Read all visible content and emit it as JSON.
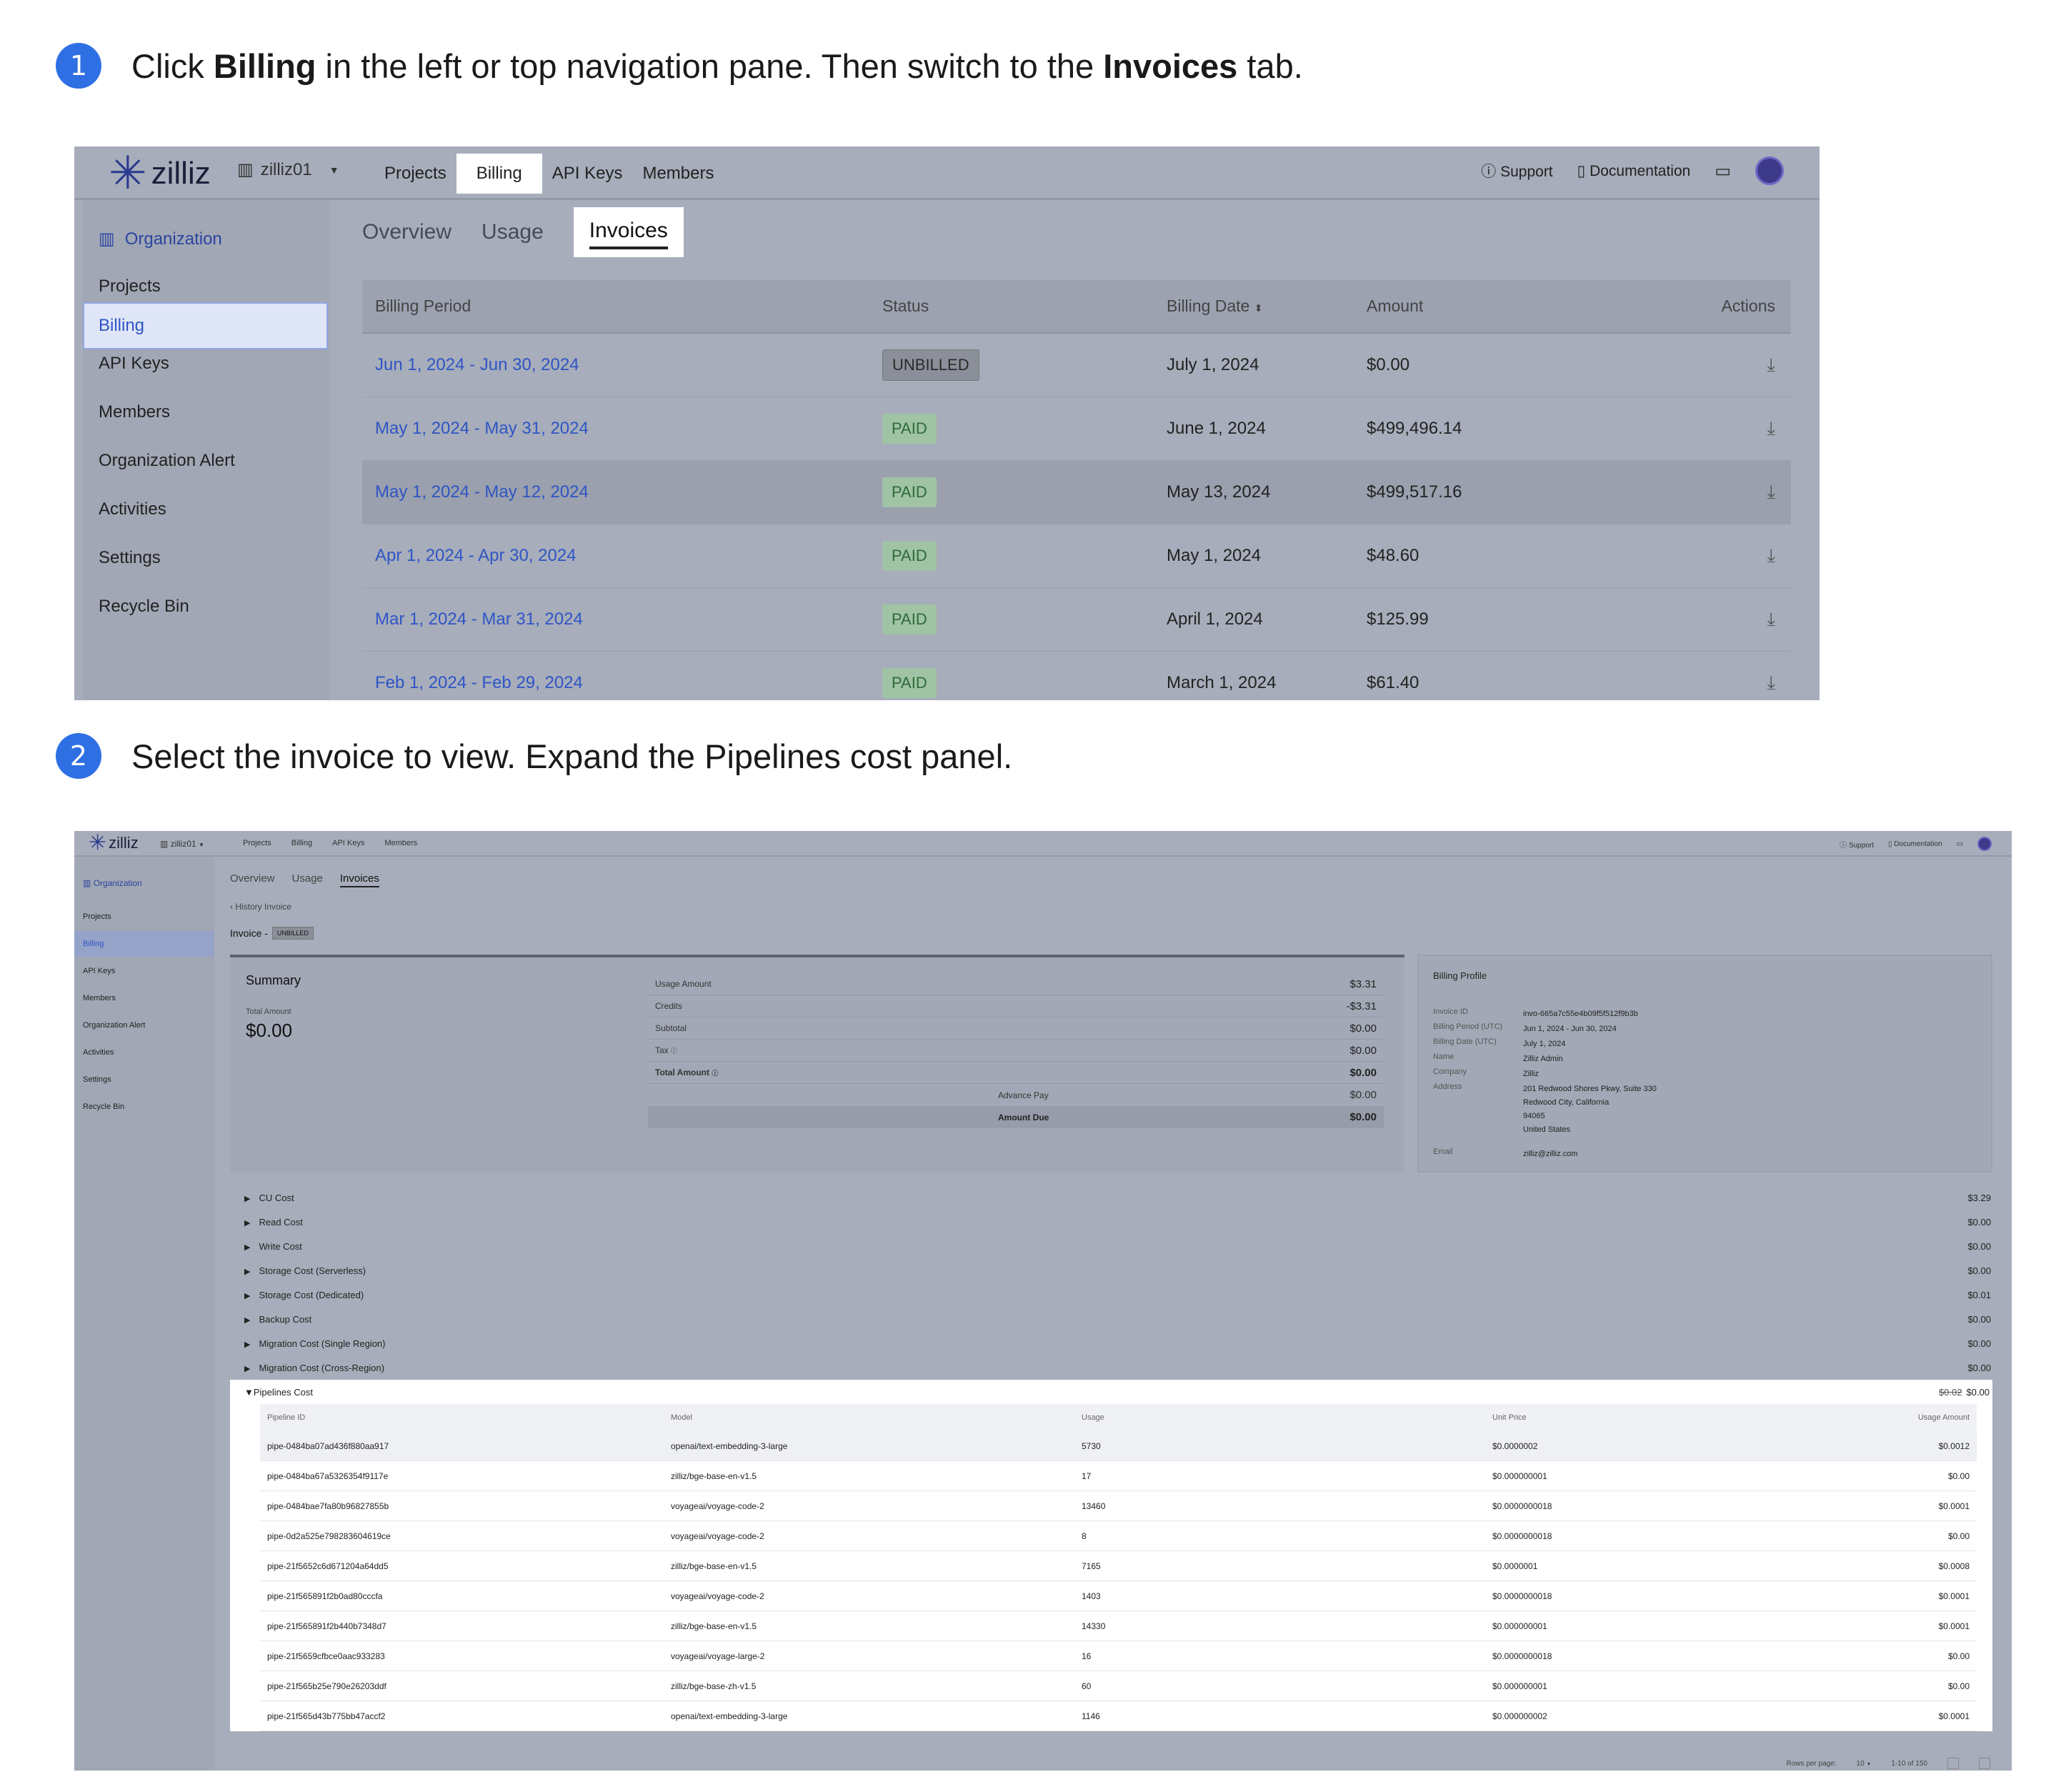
{
  "steps": [
    {
      "number": "1",
      "prefix": "Click ",
      "bold1": "Billing",
      "middle": " in the left or top navigation pane. Then switch to the ",
      "bold2": "Invoices",
      "suffix": " tab."
    },
    {
      "number": "2",
      "text": "Select the invoice to view. Expand the Pipelines cost panel."
    }
  ],
  "shot1": {
    "brand": "zilliz",
    "org_switcher": "zilliz01",
    "top_nav": [
      "Projects",
      "Billing",
      "API Keys",
      "Members"
    ],
    "top_right": {
      "support": "Support",
      "documentation": "Documentation"
    },
    "sidebar": {
      "org_label": "Organization",
      "items": [
        "Projects",
        "Billing",
        "API Keys",
        "Members",
        "Organization Alert",
        "Activities",
        "Settings",
        "Recycle Bin"
      ]
    },
    "tabs": [
      "Overview",
      "Usage",
      "Invoices"
    ],
    "table": {
      "headers": [
        "Billing Period",
        "Status",
        "Billing Date",
        "Amount",
        "Actions"
      ],
      "rows": [
        {
          "period": "Jun 1, 2024 - Jun 30, 2024",
          "status": "UNBILLED",
          "date": "July 1, 2024",
          "amount": "$0.00"
        },
        {
          "period": "May 1, 2024 - May 31, 2024",
          "status": "PAID",
          "date": "June 1, 2024",
          "amount": "$499,496.14"
        },
        {
          "period": "May 1, 2024 - May 12, 2024",
          "status": "PAID",
          "date": "May 13, 2024",
          "amount": "$499,517.16"
        },
        {
          "period": "Apr 1, 2024 - Apr 30, 2024",
          "status": "PAID",
          "date": "May 1, 2024",
          "amount": "$48.60"
        },
        {
          "period": "Mar 1, 2024 - Mar 31, 2024",
          "status": "PAID",
          "date": "April 1, 2024",
          "amount": "$125.99"
        },
        {
          "period": "Feb 1, 2024 - Feb 29, 2024",
          "status": "PAID",
          "date": "March 1, 2024",
          "amount": "$61.40"
        }
      ]
    }
  },
  "shot2": {
    "brand": "zilliz",
    "org_switcher": "zilliz01",
    "top_nav": [
      "Projects",
      "Billing",
      "API Keys",
      "Members"
    ],
    "top_right": {
      "support": "Support",
      "documentation": "Documentation"
    },
    "sidebar": {
      "org_label": "Organization",
      "items": [
        "Projects",
        "Billing",
        "API Keys",
        "Members",
        "Organization Alert",
        "Activities",
        "Settings",
        "Recycle Bin"
      ]
    },
    "tabs": [
      "Overview",
      "Usage",
      "Invoices"
    ],
    "breadcrumb": "History Invoice",
    "invoice_title": "Invoice -",
    "invoice_status": "UNBILLED",
    "summary": {
      "title": "Summary",
      "total_label": "Total Amount",
      "total_value": "$0.00",
      "rows": [
        {
          "label": "Usage Amount",
          "value": "$3.31"
        },
        {
          "label": "Credits",
          "value": "-$3.31"
        },
        {
          "label": "Subtotal",
          "value": "$0.00"
        },
        {
          "label": "Tax",
          "value": "$0.00"
        },
        {
          "label": "Total Amount",
          "value": "$0.00"
        }
      ],
      "advance_pay_label": "Advance Pay",
      "advance_pay_value": "$0.00",
      "amount_due_label": "Amount Due",
      "amount_due_value": "$0.00"
    },
    "profile": {
      "title": "Billing Profile",
      "invoice_id_label": "Invoice ID",
      "invoice_id": "invo-665a7c55e4b09f5f512f9b3b",
      "period_label": "Billing Period (UTC)",
      "period": "Jun 1, 2024 - Jun 30, 2024",
      "date_label": "Billing Date (UTC)",
      "date": "July 1, 2024",
      "name_label": "Name",
      "name": "Zilliz Admin",
      "company_label": "Company",
      "company": "Zilliz",
      "address_label": "Address",
      "address_lines": [
        "201 Redwood Shores Pkwy, Suite 330",
        "Redwood City, California",
        "94065",
        "United States"
      ],
      "email_label": "Email",
      "email": "zilliz@zilliz.com"
    },
    "costs": [
      {
        "label": "CU Cost",
        "value": "$3.29"
      },
      {
        "label": "Read Cost",
        "value": "$0.00"
      },
      {
        "label": "Write Cost",
        "value": "$0.00"
      },
      {
        "label": "Storage Cost (Serverless)",
        "value": "$0.00"
      },
      {
        "label": "Storage Cost (Dedicated)",
        "value": "$0.01"
      },
      {
        "label": "Backup Cost",
        "value": "$0.00"
      },
      {
        "label": "Migration Cost (Single Region)",
        "value": "$0.00"
      },
      {
        "label": "Migration Cost (Cross-Region)",
        "value": "$0.00"
      }
    ],
    "pipelines": {
      "label": "Pipelines Cost",
      "original": "$0.02",
      "value": "$0.00",
      "headers": [
        "Pipeline ID",
        "Model",
        "Usage",
        "Unit Price",
        "Usage Amount"
      ],
      "rows": [
        [
          "pipe-0484ba07ad436f880aa917",
          "openai/text-embedding-3-large",
          "5730",
          "$0.0000002",
          "$0.0012"
        ],
        [
          "pipe-0484ba67a5326354f9117e",
          "zilliz/bge-base-en-v1.5",
          "17",
          "$0.000000001",
          "$0.00"
        ],
        [
          "pipe-0484bae7fa80b96827855b",
          "voyageai/voyage-code-2",
          "13460",
          "$0.0000000018",
          "$0.0001"
        ],
        [
          "pipe-0d2a525e798283604619ce",
          "voyageai/voyage-code-2",
          "8",
          "$0.0000000018",
          "$0.00"
        ],
        [
          "pipe-21f5652c6d671204a64dd5",
          "zilliz/bge-base-en-v1.5",
          "7165",
          "$0.0000001",
          "$0.0008"
        ],
        [
          "pipe-21f565891f2b0ad80cccfa",
          "voyageai/voyage-code-2",
          "1403",
          "$0.0000000018",
          "$0.0001"
        ],
        [
          "pipe-21f565891f2b440b7348d7",
          "zilliz/bge-base-en-v1.5",
          "14330",
          "$0.000000001",
          "$0.0001"
        ],
        [
          "pipe-21f5659cfbce0aac933283",
          "voyageai/voyage-large-2",
          "16",
          "$0.0000000018",
          "$0.00"
        ],
        [
          "pipe-21f565b25e790e26203ddf",
          "zilliz/bge-base-zh-v1.5",
          "60",
          "$0.000000001",
          "$0.00"
        ],
        [
          "pipe-21f565d43b775bb47accf2",
          "openai/text-embedding-3-large",
          "1146",
          "$0.000000002",
          "$0.0001"
        ]
      ]
    },
    "pager": {
      "rows_per_page": "Rows per page:",
      "per_page_value": "10",
      "range": "1-10 of 150"
    }
  }
}
